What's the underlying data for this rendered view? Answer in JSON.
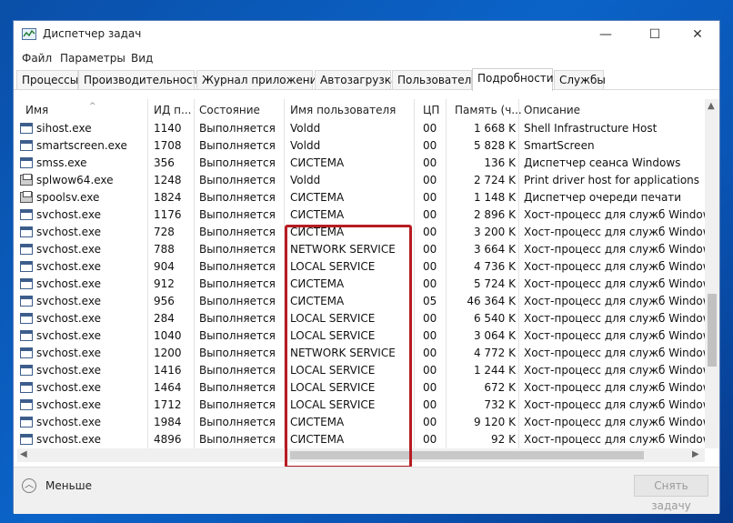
{
  "window": {
    "title": "Диспетчер задач"
  },
  "controls": {
    "minimize": "—",
    "maximize": "☐",
    "close": "✕"
  },
  "menu": [
    "Файл",
    "Параметры",
    "Вид"
  ],
  "tabs": [
    "Процессы",
    "Производительность",
    "Журнал приложений",
    "Автозагрузка",
    "Пользователи",
    "Подробности",
    "Службы"
  ],
  "active_tab": "Подробности",
  "columns": [
    "Имя",
    "ИД п...",
    "Состояние",
    "Имя пользователя",
    "ЦП",
    "Память (ч...",
    "Описание"
  ],
  "sorted_column": "Имя",
  "rows": [
    {
      "name": "sihost.exe",
      "pid": "1140",
      "status": "Выполняется",
      "user": "Voldd",
      "cpu": "00",
      "mem": "1 668 K",
      "desc": "Shell Infrastructure Host",
      "icon": "app-icon"
    },
    {
      "name": "smartscreen.exe",
      "pid": "1708",
      "status": "Выполняется",
      "user": "Voldd",
      "cpu": "00",
      "mem": "5 828 K",
      "desc": "SmartScreen",
      "icon": "app-icon"
    },
    {
      "name": "smss.exe",
      "pid": "356",
      "status": "Выполняется",
      "user": "СИСТЕМА",
      "cpu": "00",
      "mem": "136 K",
      "desc": "Диспетчер сеанса  Windows",
      "icon": "app-icon"
    },
    {
      "name": "splwow64.exe",
      "pid": "1248",
      "status": "Выполняется",
      "user": "Voldd",
      "cpu": "00",
      "mem": "2 724 K",
      "desc": "Print driver host for applications",
      "icon": "printer-icon"
    },
    {
      "name": "spoolsv.exe",
      "pid": "1824",
      "status": "Выполняется",
      "user": "СИСТЕМА",
      "cpu": "00",
      "mem": "1 148 K",
      "desc": "Диспетчер очереди печати",
      "icon": "printer-icon"
    },
    {
      "name": "svchost.exe",
      "pid": "1176",
      "status": "Выполняется",
      "user": "СИСТЕМА",
      "cpu": "00",
      "mem": "2 896 K",
      "desc": "Хост-процесс для служб Windows",
      "icon": "app-icon"
    },
    {
      "name": "svchost.exe",
      "pid": "728",
      "status": "Выполняется",
      "user": "СИСТЕМА",
      "cpu": "00",
      "mem": "3 200 K",
      "desc": "Хост-процесс для служб Windows",
      "icon": "app-icon"
    },
    {
      "name": "svchost.exe",
      "pid": "788",
      "status": "Выполняется",
      "user": "NETWORK SERVICE",
      "cpu": "00",
      "mem": "3 664 K",
      "desc": "Хост-процесс для служб Windows",
      "icon": "app-icon"
    },
    {
      "name": "svchost.exe",
      "pid": "904",
      "status": "Выполняется",
      "user": "LOCAL SERVICE",
      "cpu": "00",
      "mem": "4 736 K",
      "desc": "Хост-процесс для служб Windows",
      "icon": "app-icon"
    },
    {
      "name": "svchost.exe",
      "pid": "912",
      "status": "Выполняется",
      "user": "СИСТЕМА",
      "cpu": "00",
      "mem": "5 724 K",
      "desc": "Хост-процесс для служб Windows",
      "icon": "app-icon"
    },
    {
      "name": "svchost.exe",
      "pid": "956",
      "status": "Выполняется",
      "user": "СИСТЕМА",
      "cpu": "05",
      "mem": "46 364 K",
      "desc": "Хост-процесс для служб Windows",
      "icon": "app-icon"
    },
    {
      "name": "svchost.exe",
      "pid": "284",
      "status": "Выполняется",
      "user": "LOCAL SERVICE",
      "cpu": "00",
      "mem": "6 540 K",
      "desc": "Хост-процесс для служб Windows",
      "icon": "app-icon"
    },
    {
      "name": "svchost.exe",
      "pid": "1040",
      "status": "Выполняется",
      "user": "LOCAL SERVICE",
      "cpu": "00",
      "mem": "3 064 K",
      "desc": "Хост-процесс для служб Windows",
      "icon": "app-icon"
    },
    {
      "name": "svchost.exe",
      "pid": "1200",
      "status": "Выполняется",
      "user": "NETWORK SERVICE",
      "cpu": "00",
      "mem": "4 772 K",
      "desc": "Хост-процесс для служб Windows",
      "icon": "app-icon"
    },
    {
      "name": "svchost.exe",
      "pid": "1416",
      "status": "Выполняется",
      "user": "LOCAL SERVICE",
      "cpu": "00",
      "mem": "1 244 K",
      "desc": "Хост-процесс для служб Windows",
      "icon": "app-icon"
    },
    {
      "name": "svchost.exe",
      "pid": "1464",
      "status": "Выполняется",
      "user": "LOCAL SERVICE",
      "cpu": "00",
      "mem": "672 K",
      "desc": "Хост-процесс для служб Windows",
      "icon": "app-icon"
    },
    {
      "name": "svchost.exe",
      "pid": "1712",
      "status": "Выполняется",
      "user": "LOCAL SERVICE",
      "cpu": "00",
      "mem": "732 K",
      "desc": "Хост-процесс для служб Windows",
      "icon": "app-icon"
    },
    {
      "name": "svchost.exe",
      "pid": "1984",
      "status": "Выполняется",
      "user": "СИСТЕМА",
      "cpu": "00",
      "mem": "9 120 K",
      "desc": "Хост-процесс для служб Windows",
      "icon": "app-icon"
    },
    {
      "name": "svchost.exe",
      "pid": "4896",
      "status": "Выполняется",
      "user": "СИСТЕМА",
      "cpu": "00",
      "mem": "92 K",
      "desc": "Хост-процесс для служб Windows",
      "icon": "app-icon"
    }
  ],
  "footer": {
    "less_label": "Меньше",
    "end_task_label": "Снять задачу"
  },
  "colors": {
    "highlight": "#b71c22",
    "desktop": "#0b63c8"
  }
}
